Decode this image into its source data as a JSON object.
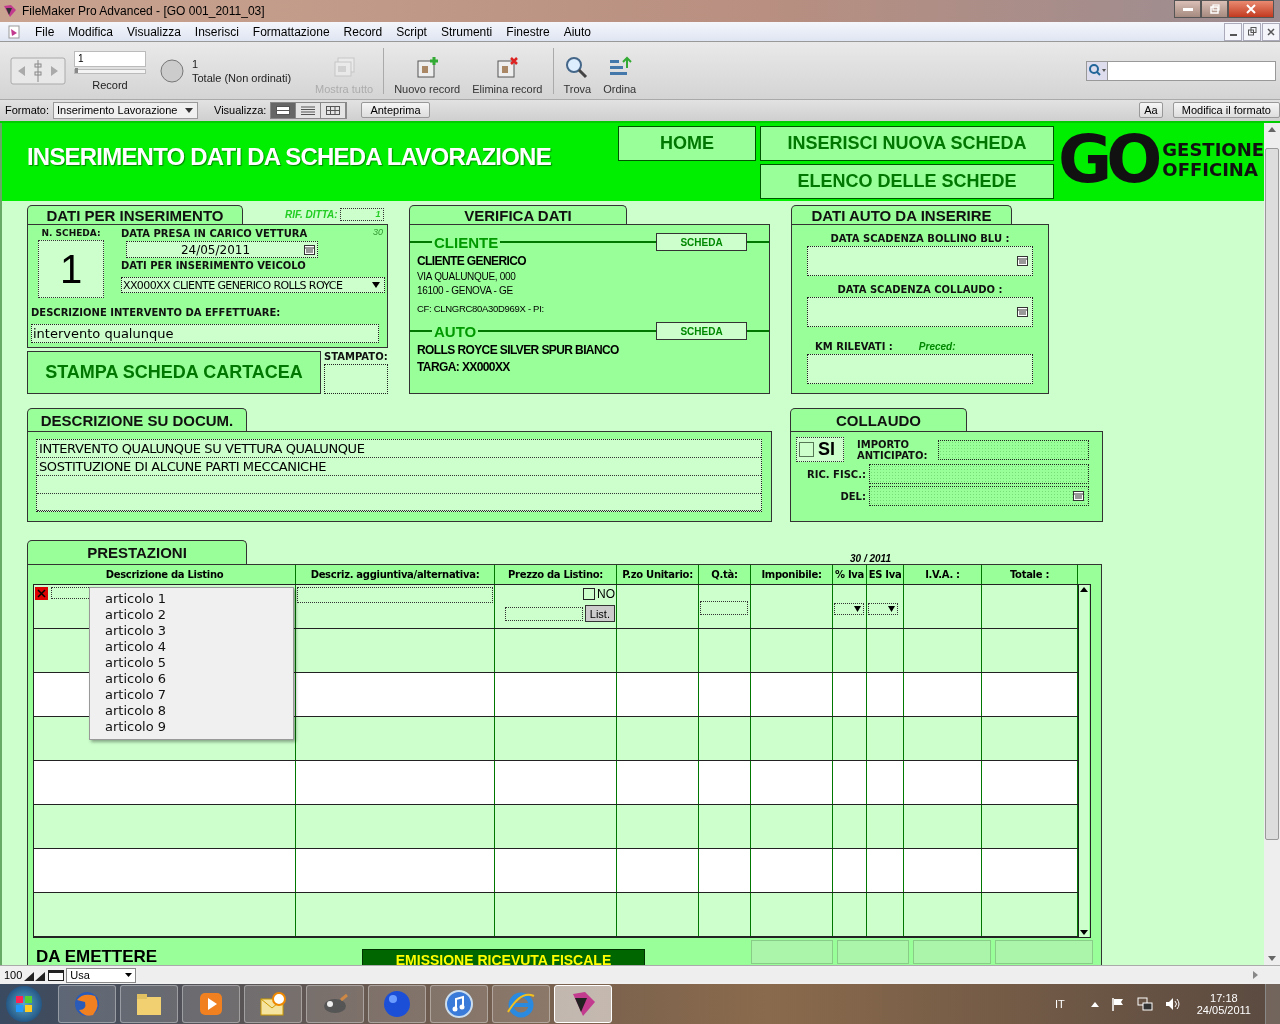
{
  "window": {
    "title": "FileMaker Pro Advanced - [GO 001_2011_03]"
  },
  "menu": [
    "File",
    "Modifica",
    "Visualizza",
    "Inserisci",
    "Formattazione",
    "Record",
    "Script",
    "Strumenti",
    "Finestre",
    "Aiuto"
  ],
  "toolbar": {
    "record_field": "1",
    "record_slider": {
      "level": 0
    },
    "record_label": "Record",
    "found_count": "1",
    "total_label": "Totale (Non ordinati)",
    "buttons": [
      {
        "label": "Mostra tutto",
        "kind": "showall",
        "disabled": true
      },
      {
        "label": "Nuovo record",
        "kind": "new",
        "disabled": false
      },
      {
        "label": "Elimina record",
        "kind": "delete",
        "disabled": false
      },
      {
        "label": "Trova",
        "kind": "find",
        "disabled": false
      },
      {
        "label": "Ordina",
        "kind": "sort",
        "disabled": false
      }
    ]
  },
  "format_bar": {
    "format_label": "Formato:",
    "format_value": "Inserimento Lavorazione",
    "view_label": "Visualizza:",
    "view_modes": [
      {
        "kind": "form",
        "selected": true
      },
      {
        "kind": "list",
        "selected": false
      },
      {
        "kind": "table",
        "selected": false
      }
    ],
    "preview_button": "Anteprima",
    "font_button": "Aa",
    "edit_button": "Modifica il formato"
  },
  "header": {
    "title": "INSERIMENTO DATI DA SCHEDA LAVORAZIONE",
    "buttons": [
      "HOME",
      "INSERISCI NUOVA SCHEDA",
      "ELENCO DELLE SCHEDE"
    ],
    "logo": {
      "mark": "GO",
      "line1": "GESTIONE",
      "line2": "OFFICINA"
    }
  },
  "dati_inserimento": {
    "tab": "DATI PER INSERIMENTO",
    "rif_label": "RIF. DITTA:",
    "rif_value": "1",
    "corner_note": "30",
    "scheda_label": "N. SCHEDA:",
    "scheda_value": "1",
    "date_label": "DATA PRESA IN CARICO VETTURA",
    "date_value": "24/05/2011",
    "vehicle_label": "DATI PER INSERIMENTO VEICOLO",
    "vehicle_value": "XX000XX CLIENTE GENERICO ROLLS ROYCE",
    "desc_label": "DESCRIZIONE INTERVENTO DA EFFETTUARE:",
    "desc_value": "intervento qualunque"
  },
  "print": {
    "button": "STAMPA SCHEDA CARTACEA",
    "printed_label": "STAMPATO:"
  },
  "verifica": {
    "tab": "VERIFICA DATI",
    "sections": [
      {
        "title": "CLIENTE",
        "button": "SCHEDA",
        "lines": [
          {
            "text": "CLIENTE GENERICO",
            "kind": "strong"
          },
          {
            "text": "VIA QUALUNQUE, 000",
            "kind": "small"
          },
          {
            "text": "16100 - GENOVA - GE",
            "kind": "small"
          },
          {
            "text": "CF: CLNGRC80A30D969X - PI:",
            "kind": "note"
          }
        ]
      },
      {
        "title": "AUTO",
        "button": "SCHEDA",
        "lines": [
          {
            "text": "ROLLS ROYCE SILVER SPUR BIANCO",
            "kind": "strong"
          },
          {
            "text": "TARGA: XX000XX",
            "kind": "strong"
          }
        ]
      }
    ]
  },
  "dati_auto": {
    "tab": "DATI AUTO DA INSERIRE",
    "date_fields": [
      "DATA SCADENZA BOLLINO BLU :",
      "DATA SCADENZA COLLAUDO :"
    ],
    "km_label": "KM RILEVATI :",
    "km_prev": "Preced:"
  },
  "descrizione_doc": {
    "tab": "DESCRIZIONE SU DOCUM.",
    "lines": [
      "INTERVENTO QUALUNQUE SU VETTURA QUALUNQUE",
      "SOSTITUZIONE DI ALCUNE PARTI MECCANICHE"
    ]
  },
  "collaudo": {
    "tab": "COLLAUDO",
    "si_label": "SI",
    "checked": false,
    "importo_label": "IMPORTO ANTICIPATO:",
    "ric_label": "RIC. FISC.:",
    "del_label": "DEL:"
  },
  "prestazioni": {
    "tab": "PRESTAZIONI",
    "period": "30 / 2011",
    "columns": [
      "Descrizione da Listino",
      "Descriz. aggiuntiva/alternativa:",
      "Prezzo da Listino:",
      "P.zo Unitario:",
      "Q.tà:",
      "Imponibile:",
      "% Iva",
      "ES Iva",
      "I.V.A. :",
      "Totale :"
    ],
    "no_label": "NO",
    "no_checked": false,
    "list_button": "List.",
    "dropdown": [
      "articolo 1",
      "articolo 2",
      "articolo 3",
      "articolo 4",
      "articolo 5",
      "articolo 6",
      "articolo 7",
      "articolo 8",
      "articolo 9"
    ]
  },
  "bottom": {
    "label": "DA EMETTERE",
    "button": "EMISSIONE RICEVUTA FISCALE"
  },
  "status_bar": {
    "zoom": "100",
    "mode": "Usa"
  },
  "taskbar": {
    "apps": [
      {
        "kind": "fox",
        "selected": false
      },
      {
        "kind": "folder",
        "selected": false
      },
      {
        "kind": "play",
        "selected": false
      },
      {
        "kind": "mail",
        "selected": false
      },
      {
        "kind": "paw",
        "selected": false
      },
      {
        "kind": "sphere",
        "selected": false
      },
      {
        "kind": "note",
        "selected": false
      },
      {
        "kind": "letter",
        "selected": false
      },
      {
        "kind": "cabinet",
        "selected": true
      }
    ],
    "language": "IT",
    "time": "17:18",
    "date": "24/05/2011"
  }
}
